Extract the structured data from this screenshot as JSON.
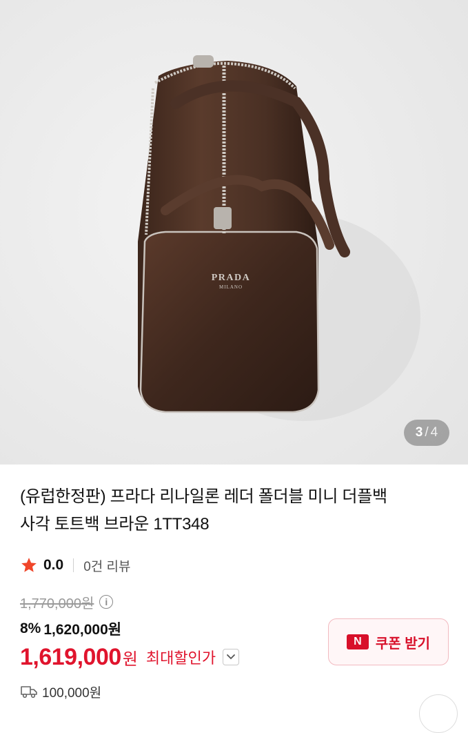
{
  "gallery": {
    "current": "3",
    "separator": "/",
    "total": "4"
  },
  "product": {
    "title_line1": "(유럽한정판) 프라다 리나일론 레더 폴더블 미니 더플백",
    "title_line2": "사각 토트백 브라운 1TT348",
    "rating": "0.0",
    "review_count_label": "0건 리뷰",
    "original_price": "1,770,000원",
    "discount_percent": "8%",
    "discounted_price": "1,620,000원",
    "final_price": "1,619,000",
    "final_currency": "원",
    "max_discount_label": "최대할인가",
    "coupon_label": "쿠폰 받기",
    "coupon_badge": "N",
    "shipping_fee": "100,000원",
    "logo_text": "PRADA",
    "logo_subtext": "MILANO"
  },
  "colors": {
    "accent_red": "#e0142d",
    "star": "#f0462a",
    "bag_brown": "#4a2e22"
  },
  "icons": [
    "star-icon",
    "info-icon",
    "chevron-down-icon",
    "coupon-icon",
    "truck-icon"
  ]
}
